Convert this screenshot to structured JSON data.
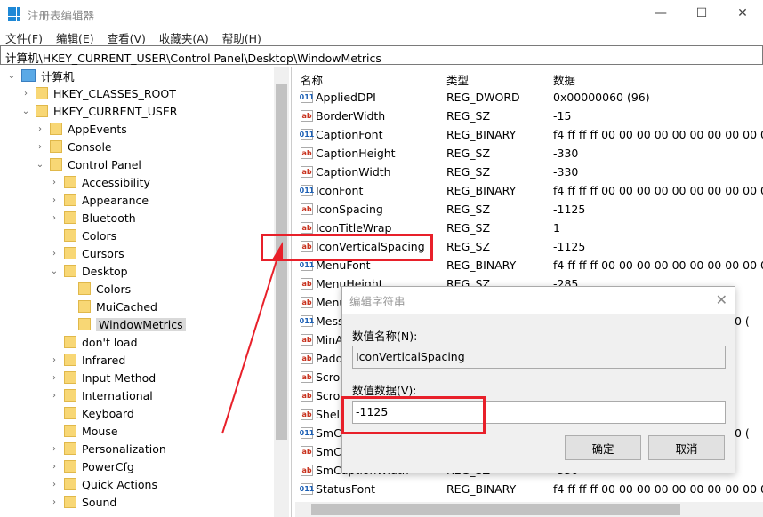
{
  "window": {
    "title": "注册表编辑器",
    "controls": [
      "—",
      "☐",
      "✕"
    ]
  },
  "menu": [
    "文件(F)",
    "编辑(E)",
    "查看(V)",
    "收藏夹(A)",
    "帮助(H)"
  ],
  "address": "计算机\\HKEY_CURRENT_USER\\Control Panel\\Desktop\\WindowMetrics",
  "tree": [
    {
      "label": "计算机",
      "level": 0,
      "exp": "open",
      "icon": "computer"
    },
    {
      "label": "HKEY_CLASSES_ROOT",
      "level": 1,
      "exp": "closed"
    },
    {
      "label": "HKEY_CURRENT_USER",
      "level": 1,
      "exp": "open"
    },
    {
      "label": "AppEvents",
      "level": 2,
      "exp": "closed"
    },
    {
      "label": "Console",
      "level": 2,
      "exp": "closed"
    },
    {
      "label": "Control Panel",
      "level": 2,
      "exp": "open"
    },
    {
      "label": "Accessibility",
      "level": 3,
      "exp": "closed"
    },
    {
      "label": "Appearance",
      "level": 3,
      "exp": "closed"
    },
    {
      "label": "Bluetooth",
      "level": 3,
      "exp": "closed"
    },
    {
      "label": "Colors",
      "level": 3,
      "exp": "none"
    },
    {
      "label": "Cursors",
      "level": 3,
      "exp": "closed"
    },
    {
      "label": "Desktop",
      "level": 3,
      "exp": "open"
    },
    {
      "label": "Colors",
      "level": 4,
      "exp": "none"
    },
    {
      "label": "MuiCached",
      "level": 4,
      "exp": "none"
    },
    {
      "label": "WindowMetrics",
      "level": 4,
      "exp": "none",
      "selected": true
    },
    {
      "label": "don't load",
      "level": 3,
      "exp": "none"
    },
    {
      "label": "Infrared",
      "level": 3,
      "exp": "closed"
    },
    {
      "label": "Input Method",
      "level": 3,
      "exp": "closed"
    },
    {
      "label": "International",
      "level": 3,
      "exp": "closed"
    },
    {
      "label": "Keyboard",
      "level": 3,
      "exp": "none"
    },
    {
      "label": "Mouse",
      "level": 3,
      "exp": "none"
    },
    {
      "label": "Personalization",
      "level": 3,
      "exp": "closed"
    },
    {
      "label": "PowerCfg",
      "level": 3,
      "exp": "closed"
    },
    {
      "label": "Quick Actions",
      "level": 3,
      "exp": "closed"
    },
    {
      "label": "Sound",
      "level": 3,
      "exp": "closed"
    }
  ],
  "list": {
    "headers": [
      "名称",
      "类型",
      "数据"
    ],
    "rows": [
      {
        "name": "AppliedDPI",
        "type": "REG_DWORD",
        "data": "0x00000060 (96)",
        "icon": "bin"
      },
      {
        "name": "BorderWidth",
        "type": "REG_SZ",
        "data": "-15",
        "icon": "ab"
      },
      {
        "name": "CaptionFont",
        "type": "REG_BINARY",
        "data": "f4 ff ff ff 00 00 00 00 00 00 00 00 00 0",
        "icon": "bin"
      },
      {
        "name": "CaptionHeight",
        "type": "REG_SZ",
        "data": "-330",
        "icon": "ab"
      },
      {
        "name": "CaptionWidth",
        "type": "REG_SZ",
        "data": "-330",
        "icon": "ab"
      },
      {
        "name": "IconFont",
        "type": "REG_BINARY",
        "data": "f4 ff ff ff 00 00 00 00 00 00 00 00 00 0",
        "icon": "bin"
      },
      {
        "name": "IconSpacing",
        "type": "REG_SZ",
        "data": "-1125",
        "icon": "ab"
      },
      {
        "name": "IconTitleWrap",
        "type": "REG_SZ",
        "data": "1",
        "icon": "ab"
      },
      {
        "name": "IconVerticalSpacing",
        "type": "REG_SZ",
        "data": "-1125",
        "icon": "ab"
      },
      {
        "name": "MenuFont",
        "type": "REG_BINARY",
        "data": "f4 ff ff ff 00 00 00 00 00 00 00 00 00 0",
        "icon": "bin"
      },
      {
        "name": "MenuHeight",
        "type": "REG_SZ",
        "data": "-285",
        "icon": "ab"
      },
      {
        "name": "Menu",
        "type": "",
        "data": "",
        "icon": "ab"
      },
      {
        "name": "Mess",
        "type": "",
        "data": "0 (",
        "icon": "bin"
      },
      {
        "name": "MinA",
        "type": "",
        "data": "",
        "icon": "ab"
      },
      {
        "name": "Padd",
        "type": "",
        "data": "",
        "icon": "ab"
      },
      {
        "name": "Scrol",
        "type": "",
        "data": "",
        "icon": "ab"
      },
      {
        "name": "Scrol",
        "type": "",
        "data": "",
        "icon": "ab"
      },
      {
        "name": "Shell",
        "type": "",
        "data": "",
        "icon": "ab"
      },
      {
        "name": "SmCa",
        "type": "",
        "data": "0 (",
        "icon": "bin"
      },
      {
        "name": "SmCa",
        "type": "",
        "data": "",
        "icon": "ab"
      },
      {
        "name": "SmCaptionWidth",
        "type": "REG_SZ",
        "data": "-330",
        "icon": "ab"
      },
      {
        "name": "StatusFont",
        "type": "REG_BINARY",
        "data": "f4 ff ff ff 00 00 00 00 00 00 00 00 00 0",
        "icon": "bin"
      }
    ]
  },
  "dialog": {
    "title": "编辑字符串",
    "name_label": "数值名称(N):",
    "name_value": "IconVerticalSpacing",
    "data_label": "数值数据(V):",
    "data_value": "-1125",
    "ok": "确定",
    "cancel": "取消"
  },
  "colors": {
    "highlight": "#e8202a",
    "folder": "#f8d775"
  }
}
